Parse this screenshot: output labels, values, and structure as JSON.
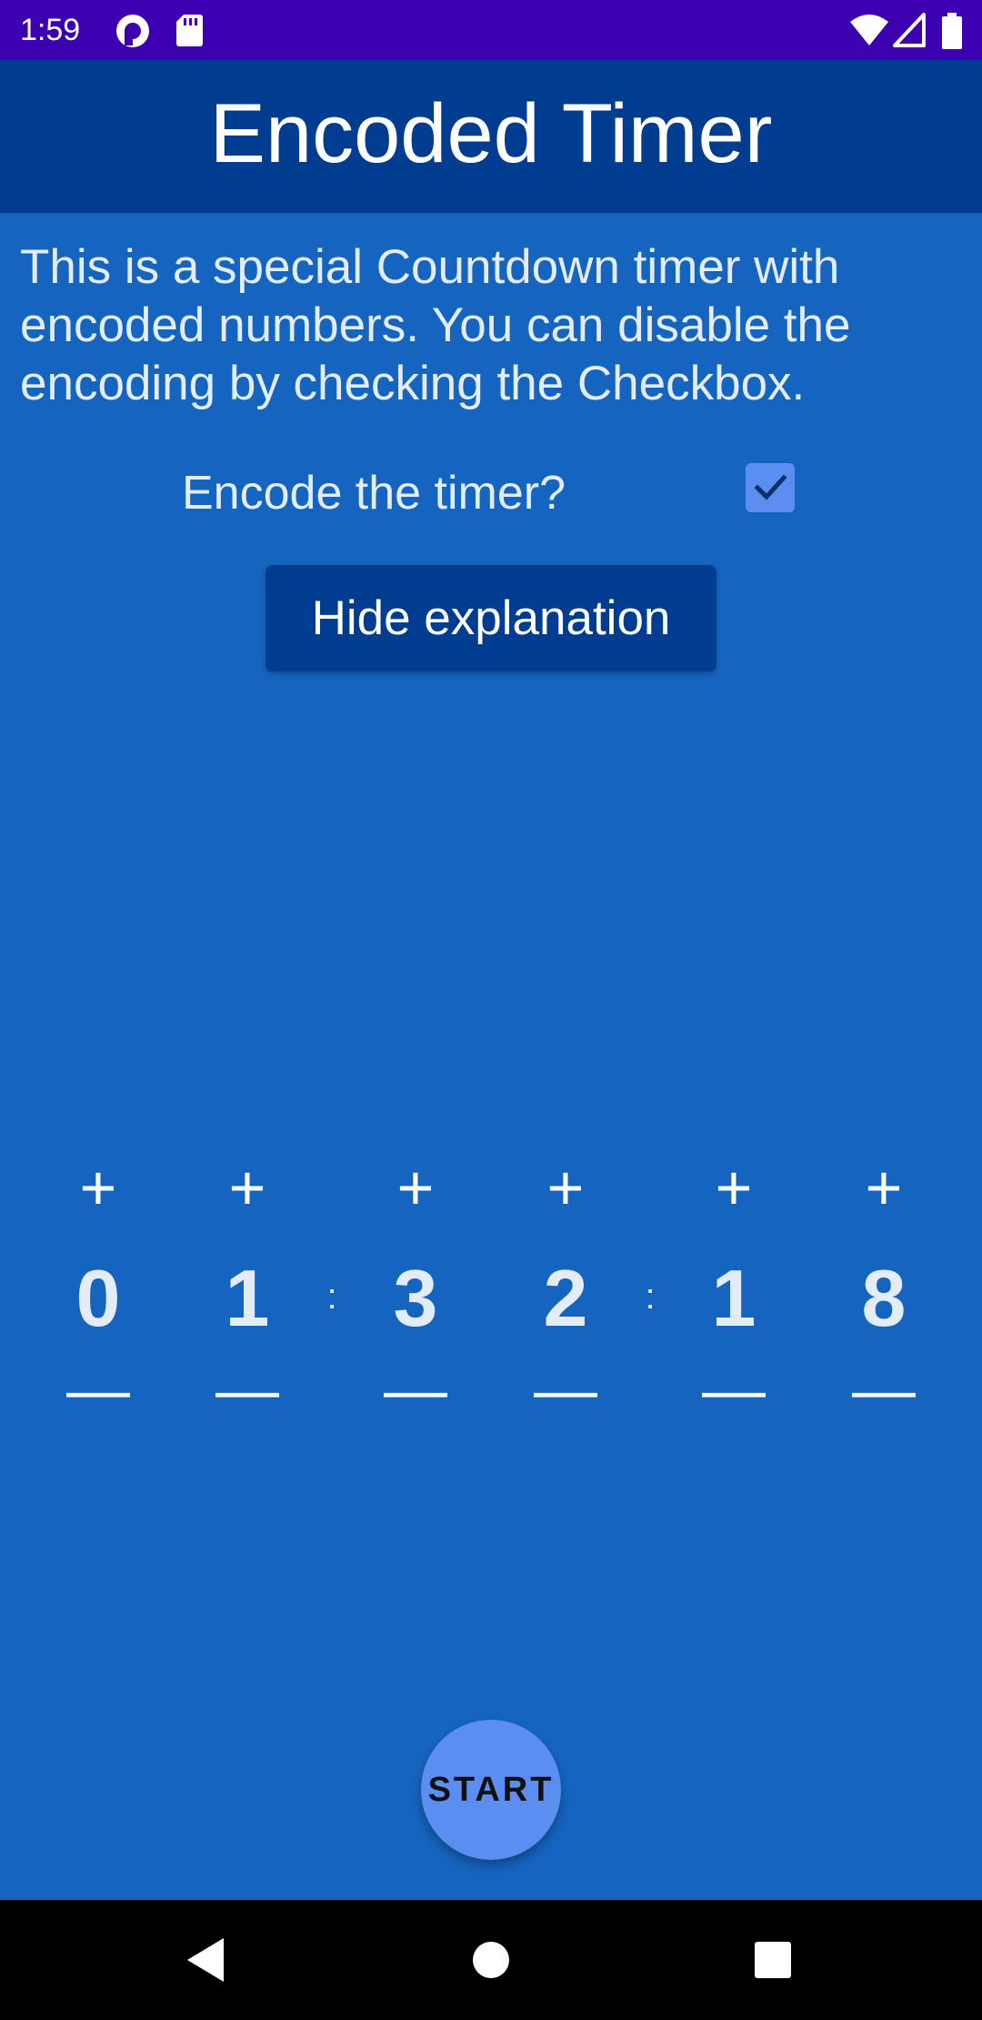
{
  "status_bar": {
    "time": "1:59",
    "icons": [
      "pocket-casts-icon",
      "sd-card-icon",
      "wifi-icon",
      "signal-icon",
      "battery-icon"
    ]
  },
  "app_bar": {
    "title": "Encoded Timer"
  },
  "explanation": {
    "text": "This is a special Countdown timer with encoded numbers. You can disable the encoding by checking the Checkbox."
  },
  "encode": {
    "label": "Encode the timer?",
    "checked": true
  },
  "hide_button": {
    "label": "Hide explanation"
  },
  "timer": {
    "plus_symbol": "+",
    "minus_symbol": "—",
    "separator": ":",
    "digits": [
      "0",
      "1",
      "3",
      "2",
      "1",
      "8"
    ]
  },
  "start_button": {
    "label": "START"
  },
  "colors": {
    "status_bar": "#3d00b0",
    "app_bar": "#003c8f",
    "background": "#1565c0",
    "accent": "#5c8df0"
  },
  "nav_bar": {
    "icons": [
      "back-icon",
      "home-icon",
      "recents-icon"
    ]
  }
}
